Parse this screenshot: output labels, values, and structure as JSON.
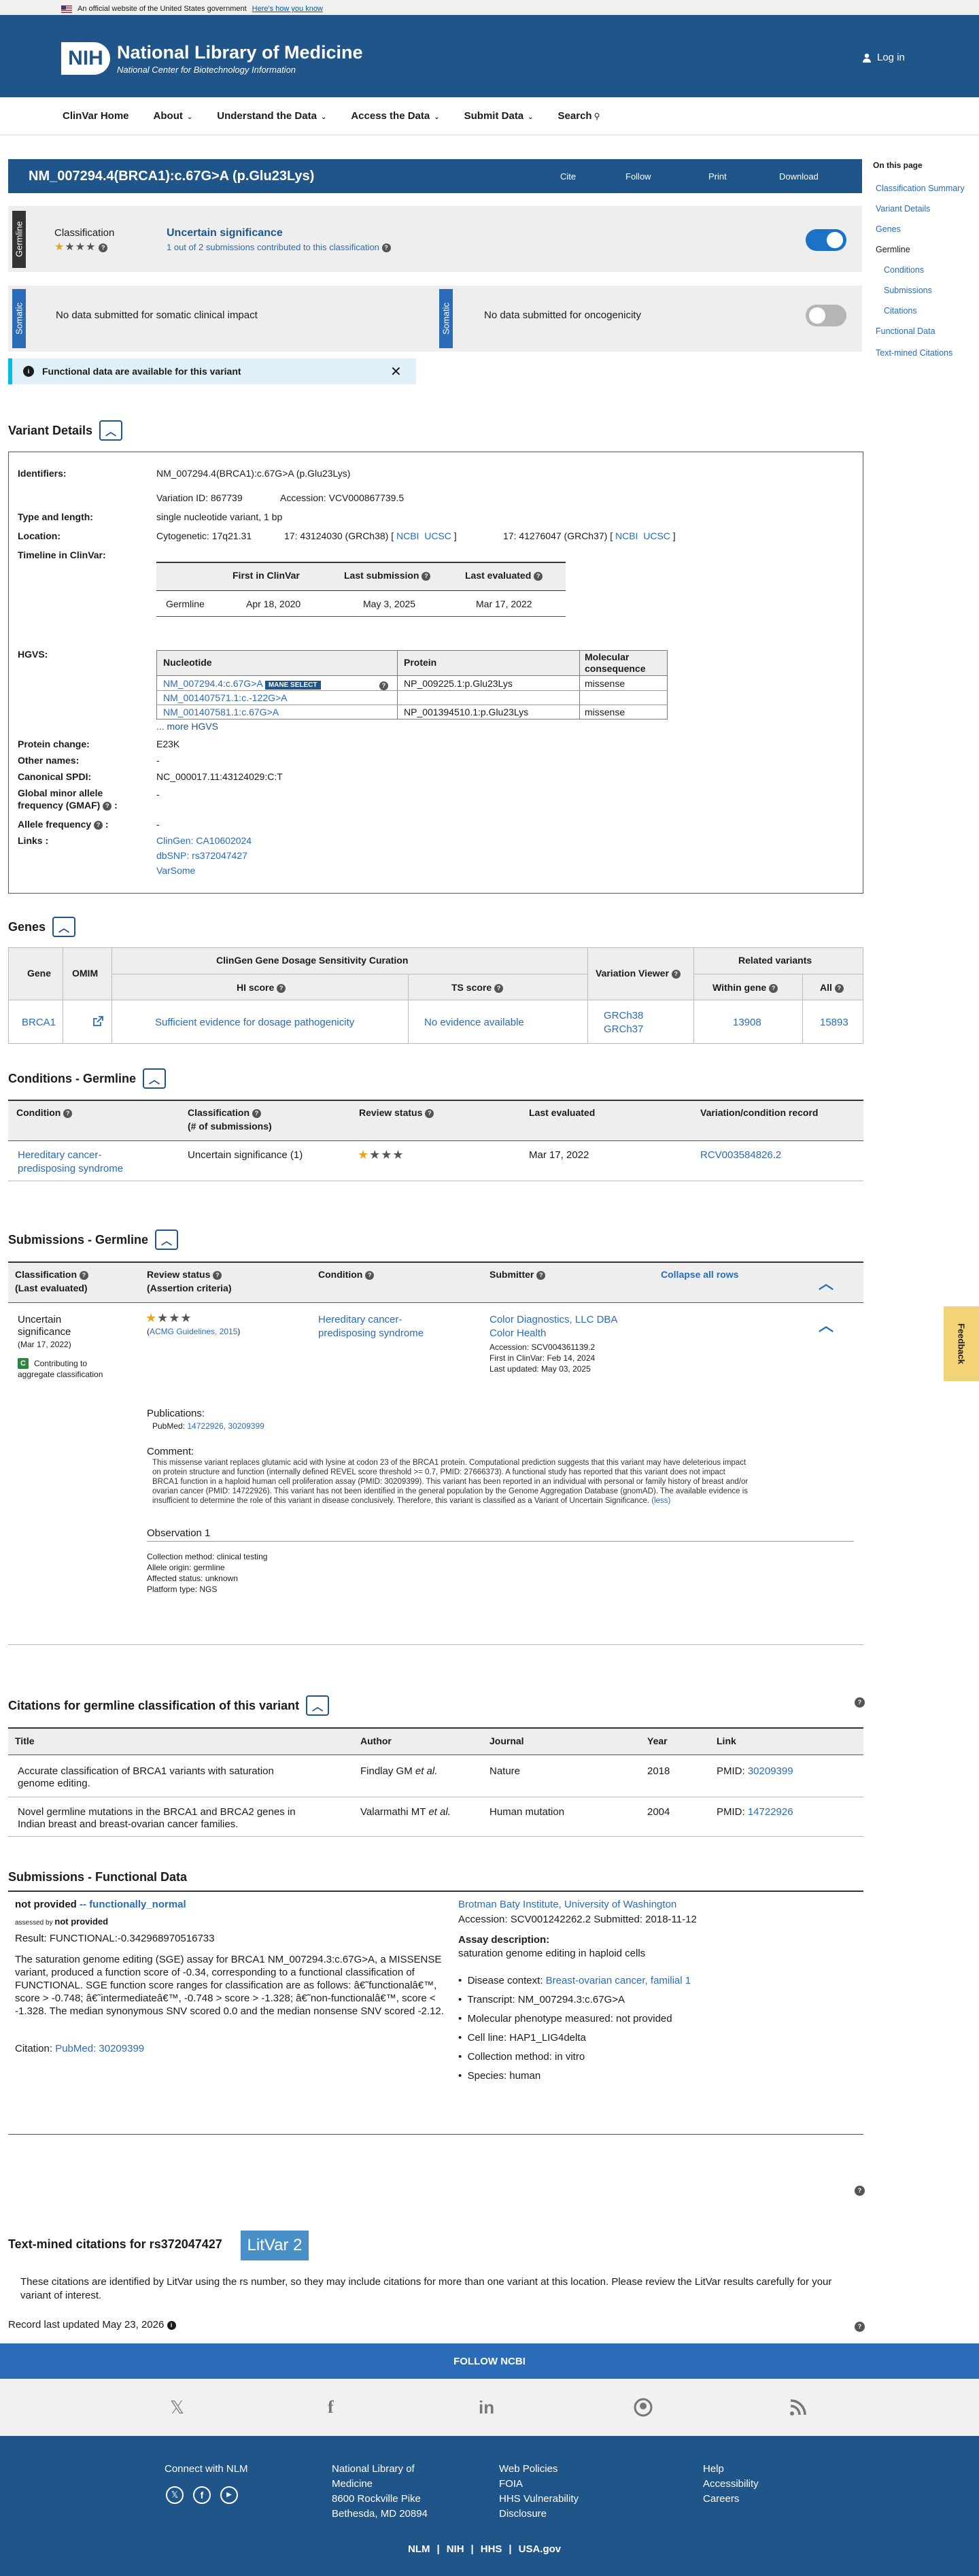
{
  "gov_banner": {
    "text": "An official website of the United States government",
    "link": "Here's how you know"
  },
  "header": {
    "logo": "NIH",
    "title": "National Library of Medicine",
    "subtitle": "National Center for Biotechnology Information",
    "login": "Log in"
  },
  "nav": {
    "items": [
      "ClinVar Home",
      "About",
      "Understand the Data",
      "Access the Data",
      "Submit Data",
      "Search"
    ]
  },
  "variant": {
    "title": "NM_007294.4(BRCA1):c.67G>A (p.Glu23Lys)",
    "actions": [
      "Cite",
      "Follow",
      "Print",
      "Download"
    ]
  },
  "toc": {
    "title": "On this page",
    "items": [
      "Classification Summary",
      "Variant Details",
      "Genes",
      "Germline",
      "Conditions",
      "Submissions",
      "Citations",
      "Functional Data",
      "Text-mined Citations"
    ]
  },
  "germline": {
    "label": "Germline",
    "classification_label": "Classification",
    "classification": "Uncertain significance",
    "submissions_link": "1 out of 2",
    "submissions_text": "submissions contributed to this classification"
  },
  "somatic": {
    "label": "Somatic",
    "left": "No data submitted for somatic clinical impact",
    "right": "No data submitted for oncogenicity"
  },
  "functional_alert": "Functional data are available for this variant",
  "variant_details": {
    "heading": "Variant Details",
    "identifiers_label": "Identifiers:",
    "identifiers": "NM_007294.4(BRCA1):c.67G>A (p.Glu23Lys)",
    "variation_id": "Variation ID: 867739",
    "accession": "Accession: VCV000867739.5",
    "type_label": "Type and length:",
    "type": "single nucleotide variant, 1 bp",
    "location_label": "Location:",
    "cyto": "Cytogenetic: 17q21.31",
    "loc38": "17: 43124030 (GRCh38) [",
    "loc37": "17: 41276047 (GRCh37) [",
    "ncbi": "NCBI",
    "ucsc": "UCSC",
    "bracket": "]",
    "timeline_label": "Timeline in ClinVar:",
    "timeline_headers": [
      "First in ClinVar",
      "Last submission",
      "Last evaluated"
    ],
    "timeline_row": [
      "Germline",
      "Apr 18, 2020",
      "May 3, 2025",
      "Mar 17, 2022"
    ],
    "hgvs_label": "HGVS:",
    "hgvs_headers": [
      "Nucleotide",
      "Protein",
      "Molecular consequence"
    ],
    "hgvs_rows": [
      [
        "NM_007294.4:c.67G>A",
        "NP_009225.1:p.Glu23Lys",
        "missense"
      ],
      [
        "NM_001407571.1:c.-122G>A",
        "",
        ""
      ],
      [
        "NM_001407581.1:c.67G>A",
        "NP_001394510.1:p.Glu23Lys",
        "missense"
      ]
    ],
    "mane": "MANE SELECT",
    "more_hgvs": "... more HGVS",
    "protein_change_label": "Protein change:",
    "protein_change": "E23K",
    "other_names_label": "Other names:",
    "other_names": "-",
    "spdi_label": "Canonical SPDI:",
    "spdi": "NC_000017.11:43124029:C:T",
    "gmaf_label1": "Global minor allele",
    "gmaf_label2": "frequency (GMAF)",
    "gmaf": "-",
    "allele_freq_label": "Allele frequency",
    "allele_freq": "-",
    "links_label": "Links :",
    "links": [
      "ClinGen: CA10602024",
      "dbSNP: rs372047427",
      "VarSome"
    ]
  },
  "genes": {
    "heading": "Genes",
    "headers": [
      "Gene",
      "OMIM",
      "ClinGen Gene Dosage Sensitivity Curation",
      "HI score",
      "TS score",
      "Variation Viewer",
      "Related variants",
      "Within gene",
      "All"
    ],
    "row": {
      "gene": "BRCA1",
      "hi": "Sufficient evidence for dosage pathogenicity",
      "ts": "No evidence available",
      "vv1": "GRCh38",
      "vv2": "GRCh37",
      "within": "13908",
      "all": "15893"
    }
  },
  "conditions": {
    "heading": "Conditions - Germline",
    "headers": [
      "Condition",
      "Classification",
      "(# of submissions)",
      "Review status",
      "Last evaluated",
      "Variation/condition record"
    ],
    "row": {
      "condition1": "Hereditary cancer-",
      "condition2": "predisposing syndrome",
      "classification": "Uncertain significance (1)",
      "evaluated": "Mar 17, 2022",
      "record": "RCV003584826.2"
    }
  },
  "submissions": {
    "heading": "Submissions - Germline",
    "headers": [
      "Classification",
      "(Last evaluated)",
      "Review status",
      "(Assertion criteria)",
      "Condition",
      "Submitter",
      "Collapse all rows"
    ],
    "cls1": "Uncertain",
    "cls2": "significance",
    "cls_date": "(Mar 17, 2022)",
    "contrib1": "Contributing to",
    "contrib2": "aggregate classification",
    "criteria": "ACMG Guidelines, 2015",
    "paren_open": "(",
    "paren_close": ")",
    "condition1": "Hereditary cancer-",
    "condition2": "predisposing syndrome",
    "submitter1": "Color Diagnostics, LLC DBA",
    "submitter2": "Color Health",
    "accession": "Accession: SCV004361139.2",
    "first": "First in ClinVar: Feb 14, 2024",
    "updated": "Last updated: May 03, 2025",
    "publications_label": "Publications:",
    "pubmed_prefix": "PubMed:",
    "pubmed": "14722926, 30209399",
    "comment_label": "Comment:",
    "comment": "This missense variant replaces glutamic acid with lysine at codon 23 of the BRCA1 protein. Computational prediction suggests that this variant may have deleterious impact on protein structure and function (internally defined REVEL score threshold >= 0.7, PMID: 27666373). A functional study has reported that this variant does not impact BRCA1 function in a haploid human cell proliferation assay (PMID: 30209399). This variant has been reported in an individual with personal or family history of breast and/or ovarian cancer (PMID: 14722926). This variant has not been identified in the general population by the Genome Aggregation Database (gnomAD). The available evidence is insufficient to determine the role of this variant in disease conclusively. Therefore, this variant is classified as a Variant of Uncertain Significance.",
    "less": "(less)",
    "observation": "Observation 1",
    "obs_lines": [
      "Collection method: clinical testing",
      "Allele origin: germline",
      "Affected status: unknown",
      "Platform type: NGS"
    ]
  },
  "citations": {
    "heading": "Citations for germline classification of this variant",
    "headers": [
      "Title",
      "Author",
      "Journal",
      "Year",
      "Link"
    ],
    "pmid_prefix": "PMID:",
    "rows": [
      {
        "title1": "Accurate classification of BRCA1 variants with saturation",
        "title2": "genome editing.",
        "author": "Findlay GM ",
        "etal": "et al.",
        "journal": "Nature",
        "year": "2018",
        "pmid": "30209399"
      },
      {
        "title1": "Novel germline mutations in the BRCA1 and BRCA2 genes in",
        "title2": "Indian breast and breast-ovarian cancer families.",
        "author": "Valarmathi MT ",
        "etal": "et al.",
        "journal": "Human mutation",
        "year": "2004",
        "pmid": "14722926"
      }
    ]
  },
  "functional": {
    "heading": "Submissions - Functional Data",
    "status": "not provided",
    "arrow": "--",
    "status_link": "functionally_normal",
    "assessed_by": "assessed by",
    "assessed_val": "not provided",
    "result": "Result:   FUNCTIONAL:-0.342968970516733",
    "desc": "The saturation genome editing (SGE) assay for BRCA1 NM_007294.3:c.67G>A, a MISSENSE variant, produced a function score of -0.34, corresponding to a functional classification of FUNCTIONAL. SGE function score ranges for classification are as follows: â€˜functionalâ€™, score > -0.748; â€˜intermediateâ€™, -0.748 > score > -1.328; â€˜non-functionalâ€™, score < -1.328. The median synonymous SNV scored 0.0 and the median nonsense SNV scored -2.12.",
    "citation_prefix": "Citation:",
    "citation": "PubMed: 30209399",
    "submitter": "Brotman Baty Institute, University of Washington",
    "accession": "Accession: SCV001242262.2    Submitted: 2018-11-12",
    "assay_label": "Assay description:",
    "assay": "saturation genome editing in haploid cells",
    "disease_prefix": "Disease context:",
    "disease": "Breast-ovarian cancer, familial 1",
    "details": [
      "Transcript: NM_007294.3:c.67G>A",
      "Molecular phenotype measured: not provided",
      "Cell line: HAP1_LIG4delta",
      "Collection method: in vitro",
      "Species: human"
    ]
  },
  "textmined": {
    "heading": "Text-mined citations for rs372047427",
    "litvar": "LitVar 2",
    "text": "These citations are identified by LitVar using the rs number, so they may include citations for more than one variant at this location. Please review the LitVar results carefully for your variant of interest."
  },
  "record_updated": "Record last updated May 23, 2026",
  "feedback": "Feedback",
  "footer": {
    "follow": "FOLLOW NCBI",
    "connect": "Connect with NLM",
    "address": [
      "National Library of",
      "Medicine",
      "8600 Rockville Pike",
      "Bethesda, MD 20894"
    ],
    "links1": [
      "Web Policies",
      "FOIA",
      "HHS Vulnerability",
      "Disclosure"
    ],
    "links2": [
      "Help",
      "Accessibility",
      "Careers"
    ],
    "bottom": [
      "NLM",
      "NIH",
      "HHS",
      "USA.gov"
    ]
  }
}
